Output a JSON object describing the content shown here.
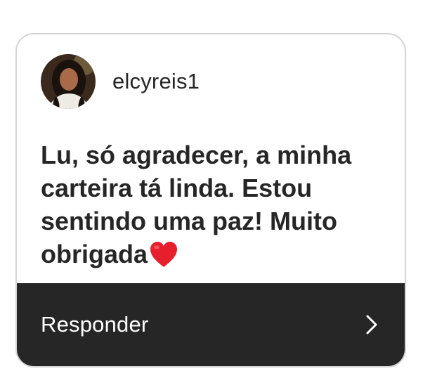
{
  "post": {
    "username": "elcyreis1",
    "message": "Lu, só agradecer, a minha carteira tá linda. Estou sentindo uma paz! Muito obrigada",
    "emoji_icon": "red-heart-icon"
  },
  "footer": {
    "reply_label": "Responder",
    "chevron_icon": "chevron-right-icon"
  },
  "colors": {
    "text": "#262626",
    "footer_bg": "#262626",
    "border": "#d4d4d4",
    "heart": "#e5202c"
  }
}
